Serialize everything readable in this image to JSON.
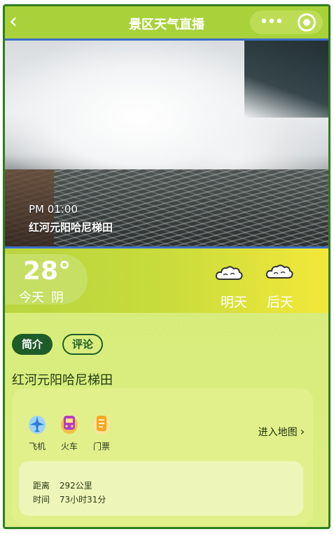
{
  "header": {
    "back_icon": "chevron-left-icon",
    "title": "景区天气直播",
    "more_icon": "more-dots-icon",
    "close_icon": "target-circle-icon"
  },
  "live": {
    "time": "PM 01:00",
    "location": "红河元阳哈尼梯田"
  },
  "weather": {
    "today_temp": "28°",
    "today_label": "今天",
    "today_condition": "阴",
    "tomorrow_label": "明天",
    "tomorrow_icon": "cloud-icon",
    "after_tomorrow_label": "后天",
    "after_tomorrow_icon": "cloud-icon"
  },
  "tabs": [
    {
      "label": "简介",
      "active": true
    },
    {
      "label": "评论",
      "active": false
    }
  ],
  "spot_name": "红河元阳哈尼梯田",
  "transport": [
    {
      "label": "飞机",
      "icon": "airplane-icon",
      "color": "#3a8fe0"
    },
    {
      "label": "火车",
      "icon": "train-icon",
      "color": "#b43cc8"
    },
    {
      "label": "门票",
      "icon": "ticket-icon",
      "color": "#f5a623"
    }
  ],
  "map_link": "进入地图",
  "distance": {
    "distance_label": "距离",
    "distance_value": "292公里",
    "time_label": "时间",
    "time_value": "73小时31分"
  },
  "colors": {
    "header_bg": "#a9d23a",
    "frame_border": "#2f7d1e",
    "active_tab": "#1e5d2a"
  }
}
